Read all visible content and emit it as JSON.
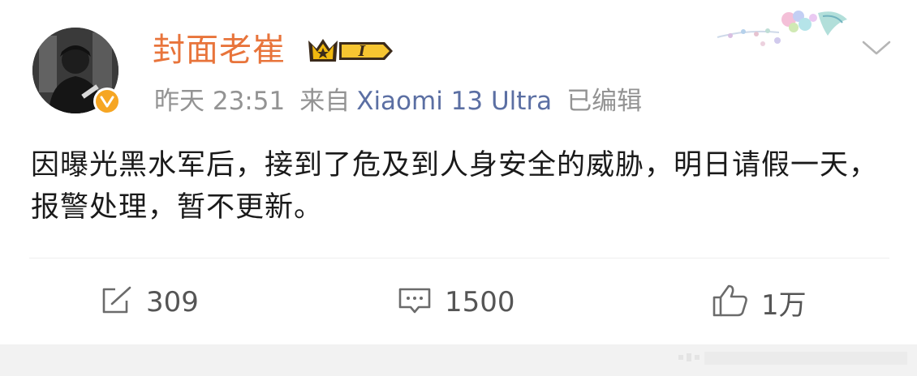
{
  "post": {
    "username": "封面老崔",
    "vip_level": "I",
    "time": "昨天 23:51",
    "source_prefix": "来自",
    "device": "Xiaomi 13 Ultra",
    "edited": "已编辑",
    "content": "因曝光黑水军后，接到了危及到人身安全的威胁，明日请假一天，报警处理，暂不更新。"
  },
  "actions": {
    "repost_count": "309",
    "comment_count": "1500",
    "like_count": "1万"
  },
  "colors": {
    "username": "#e8743b",
    "device": "#5b6fa3",
    "meta": "#939393",
    "verified_badge": "#f6a623"
  }
}
